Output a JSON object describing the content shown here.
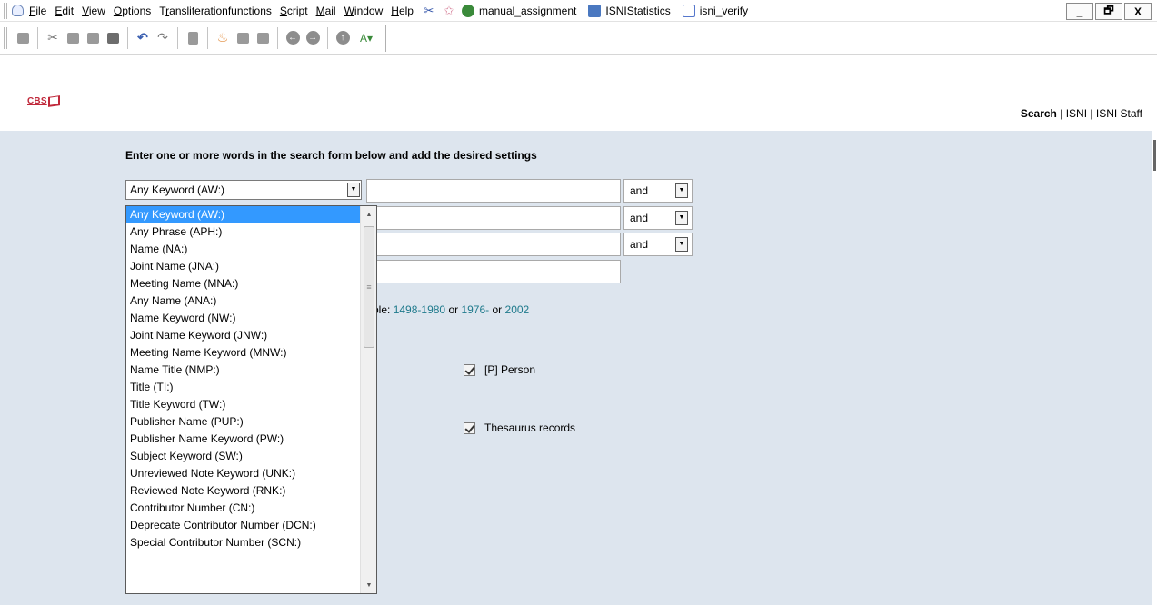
{
  "menubar": {
    "items": [
      "File",
      "Edit",
      "View",
      "Options",
      "Transliterationfunctions",
      "Script",
      "Mail",
      "Window",
      "Help"
    ],
    "underline": [
      "F",
      "E",
      "V",
      "O",
      "r",
      "S",
      "M",
      "W",
      "H"
    ],
    "quick_links": [
      {
        "label": "manual_assignment",
        "icon": "globe-icon",
        "color": "#3a8a3a"
      },
      {
        "label": "ISNIStatistics",
        "icon": "table-icon",
        "color": "#4a78c0"
      },
      {
        "label": "isni_verify",
        "icon": "checkbox-icon",
        "color": "#5577cc"
      }
    ],
    "window_controls": [
      "_",
      "🗗",
      "X"
    ]
  },
  "header": {
    "logo_text": "CBS",
    "links": [
      "Search",
      "ISNI",
      "ISNI Staff"
    ],
    "separator": "|"
  },
  "search": {
    "instruction": "Enter one or more words in the search form below and add the desired settings",
    "index_selected": "Any Keyword (AW:)",
    "operators": [
      "and",
      "and",
      "and"
    ],
    "hint_prefix": "ble:",
    "hint_date1": "1498-1980",
    "hint_or1": "or",
    "hint_date2": "1976-",
    "hint_or2": "or",
    "hint_date3": "2002",
    "checkbox_person": "[P] Person",
    "checkbox_thesaurus": "Thesaurus records"
  },
  "dropdown": {
    "options": [
      "Any Keyword (AW:)",
      "Any Phrase (APH:)",
      "Name (NA:)",
      "Joint Name (JNA:)",
      "Meeting Name (MNA:)",
      "Any Name (ANA:)",
      "Name Keyword (NW:)",
      "Joint Name Keyword (JNW:)",
      "Meeting Name Keyword (MNW:)",
      "Name Title (NMP:)",
      "Title (TI:)",
      "Title Keyword (TW:)",
      "Publisher Name (PUP:)",
      "Publisher Name Keyword (PW:)",
      "Subject Keyword (SW:)",
      "Unreviewed Note Keyword (UNK:)",
      "Reviewed Note Keyword (RNK:)",
      "Contributor Number (CN:)",
      "Deprecate Contributor Number (DCN:)",
      "Special Contributor Number (SCN:)"
    ],
    "selected_index": 0
  },
  "colors": {
    "main_bg": "#dde5ee",
    "selection": "#3399ff",
    "link": "#1f7a8c",
    "logo": "#c0283a"
  }
}
